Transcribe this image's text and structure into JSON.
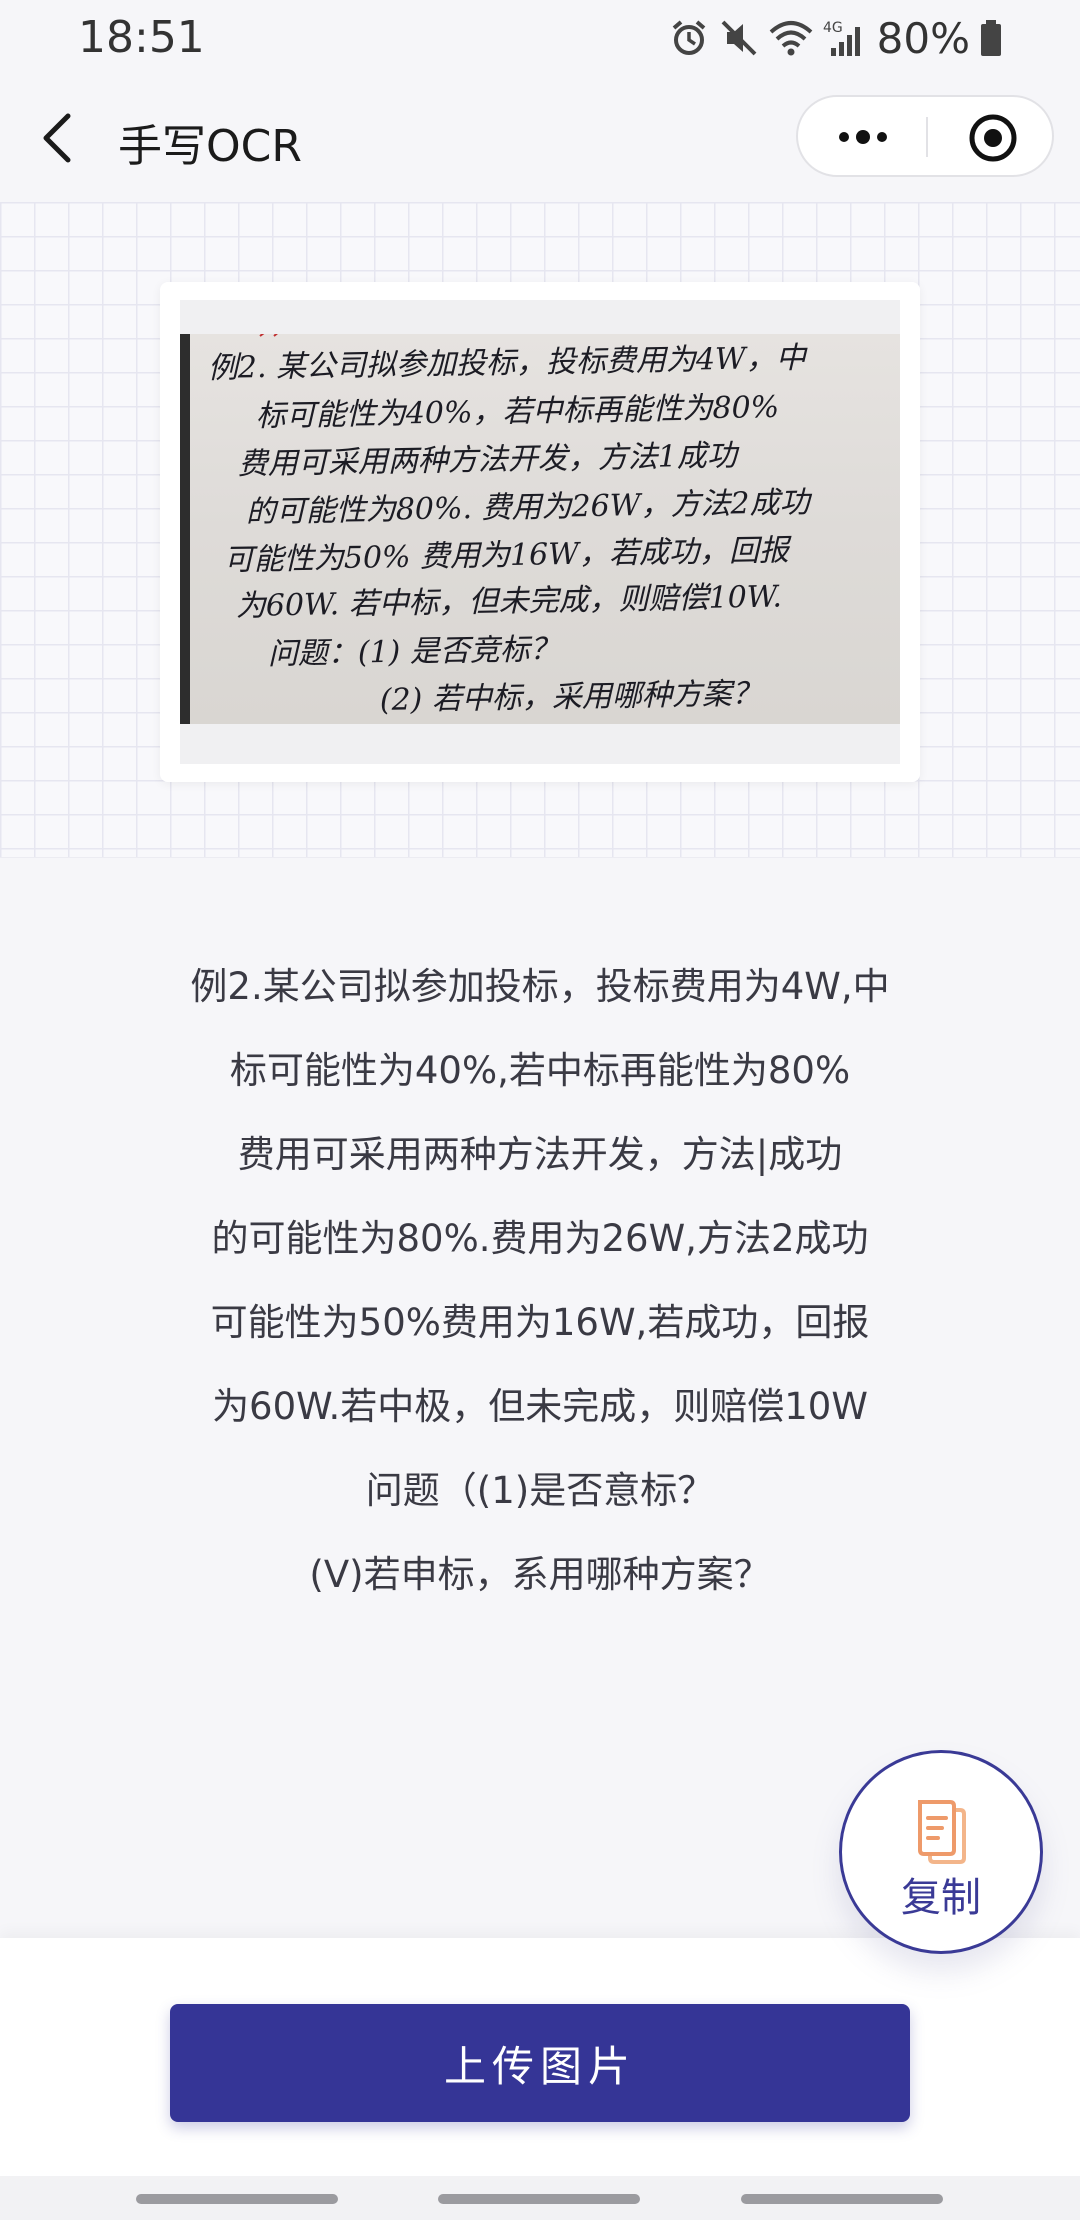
{
  "status_bar": {
    "time": "18:51",
    "network": "4G",
    "battery": "80%",
    "icons": [
      "alarm-icon",
      "mute-icon",
      "wifi-icon",
      "signal-icon",
      "battery-icon"
    ]
  },
  "nav": {
    "back_icon": "chevron-left-icon",
    "title": "手写OCR",
    "more_icon": "more-dots-icon",
    "close_icon": "target-icon"
  },
  "photo": {
    "handwritten_lines": [
      "例2. 某公司拟参加投标，投标费用为4W，中",
      "标可能性为40%，若中标再能性为80%",
      "费用可采用两种方法开发，方法1成功",
      "的可能性为80%. 费用为26W，方法2成功",
      "可能性为50% 费用为16W，若成功，回报",
      "为60W. 若中标，但未完成，则赔偿10W.",
      "问题：(1) 是否竞标？",
      "(2) 若中标，采用哪种方案？"
    ]
  },
  "result": {
    "lines": [
      "例2.某公司拟参加投标，投标费用为4W,中",
      "标可能性为40%,若中标再能性为80%",
      "费用可采用两种方法开发，方法|成功",
      "的可能性为80%.费用为26W,方法2成功",
      "可能性为50%费用为16W,若成功，回报",
      "为60W.若中极，但未完成，则赔偿10W",
      "问题（(1)是否意标？",
      "(V)若申标，系用哪种方案？"
    ]
  },
  "copy_button": {
    "label": "复制",
    "icon": "copy-document-icon",
    "accent": "#3a3a96",
    "icon_color": "#f0a070"
  },
  "upload_button": {
    "label": "上传图片",
    "color": "#353596"
  }
}
